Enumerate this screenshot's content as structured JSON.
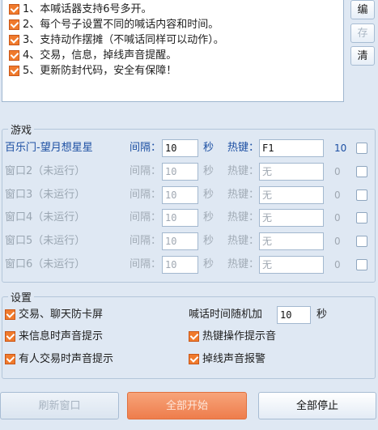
{
  "features": [
    "1、本喊话器支持6号多开。",
    "2、每个号子设置不同的喊话内容和时间。",
    "3、支持动作摆摊（不喊话同样可以动作）。",
    "4、交易，信息，掉线声音提醒。",
    "5、更新防封代码，安全有保障！"
  ],
  "side_buttons": {
    "edit": "编",
    "save": "存",
    "clear": "清"
  },
  "game_group": {
    "title": "游戏",
    "interval_label": "间隔：",
    "seconds_label": "秒",
    "hotkey_label": "热键：",
    "rows": [
      {
        "name": "百乐门-望月想星星",
        "interval": "10",
        "hotkey": "F1",
        "count": "10",
        "active": true
      },
      {
        "name": "窗口2（未运行）",
        "interval": "10",
        "hotkey": "无",
        "count": "0",
        "active": false
      },
      {
        "name": "窗口3（未运行）",
        "interval": "10",
        "hotkey": "无",
        "count": "0",
        "active": false
      },
      {
        "name": "窗口4（未运行）",
        "interval": "10",
        "hotkey": "无",
        "count": "0",
        "active": false
      },
      {
        "name": "窗口5（未运行）",
        "interval": "10",
        "hotkey": "无",
        "count": "0",
        "active": false
      },
      {
        "name": "窗口6（未运行）",
        "interval": "10",
        "hotkey": "无",
        "count": "0",
        "active": false
      }
    ]
  },
  "settings_group": {
    "title": "设置",
    "anti_freeze": "交易、聊天防卡屏",
    "random_time_label": "喊话时间随机加",
    "random_time_value": "10",
    "random_time_unit": "秒",
    "msg_sound": "来信息时声音提示",
    "hotkey_sound": "热键操作提示音",
    "trade_sound": "有人交易时声音提示",
    "disconnect_sound": "掉线声音报警"
  },
  "buttons": {
    "refresh": "刷新窗口",
    "start_all": "全部开始",
    "stop_all": "全部停止"
  },
  "colors": {
    "accent": "#f07a2c",
    "active_text": "#1c4fa3",
    "background": "#dfe8f3"
  }
}
